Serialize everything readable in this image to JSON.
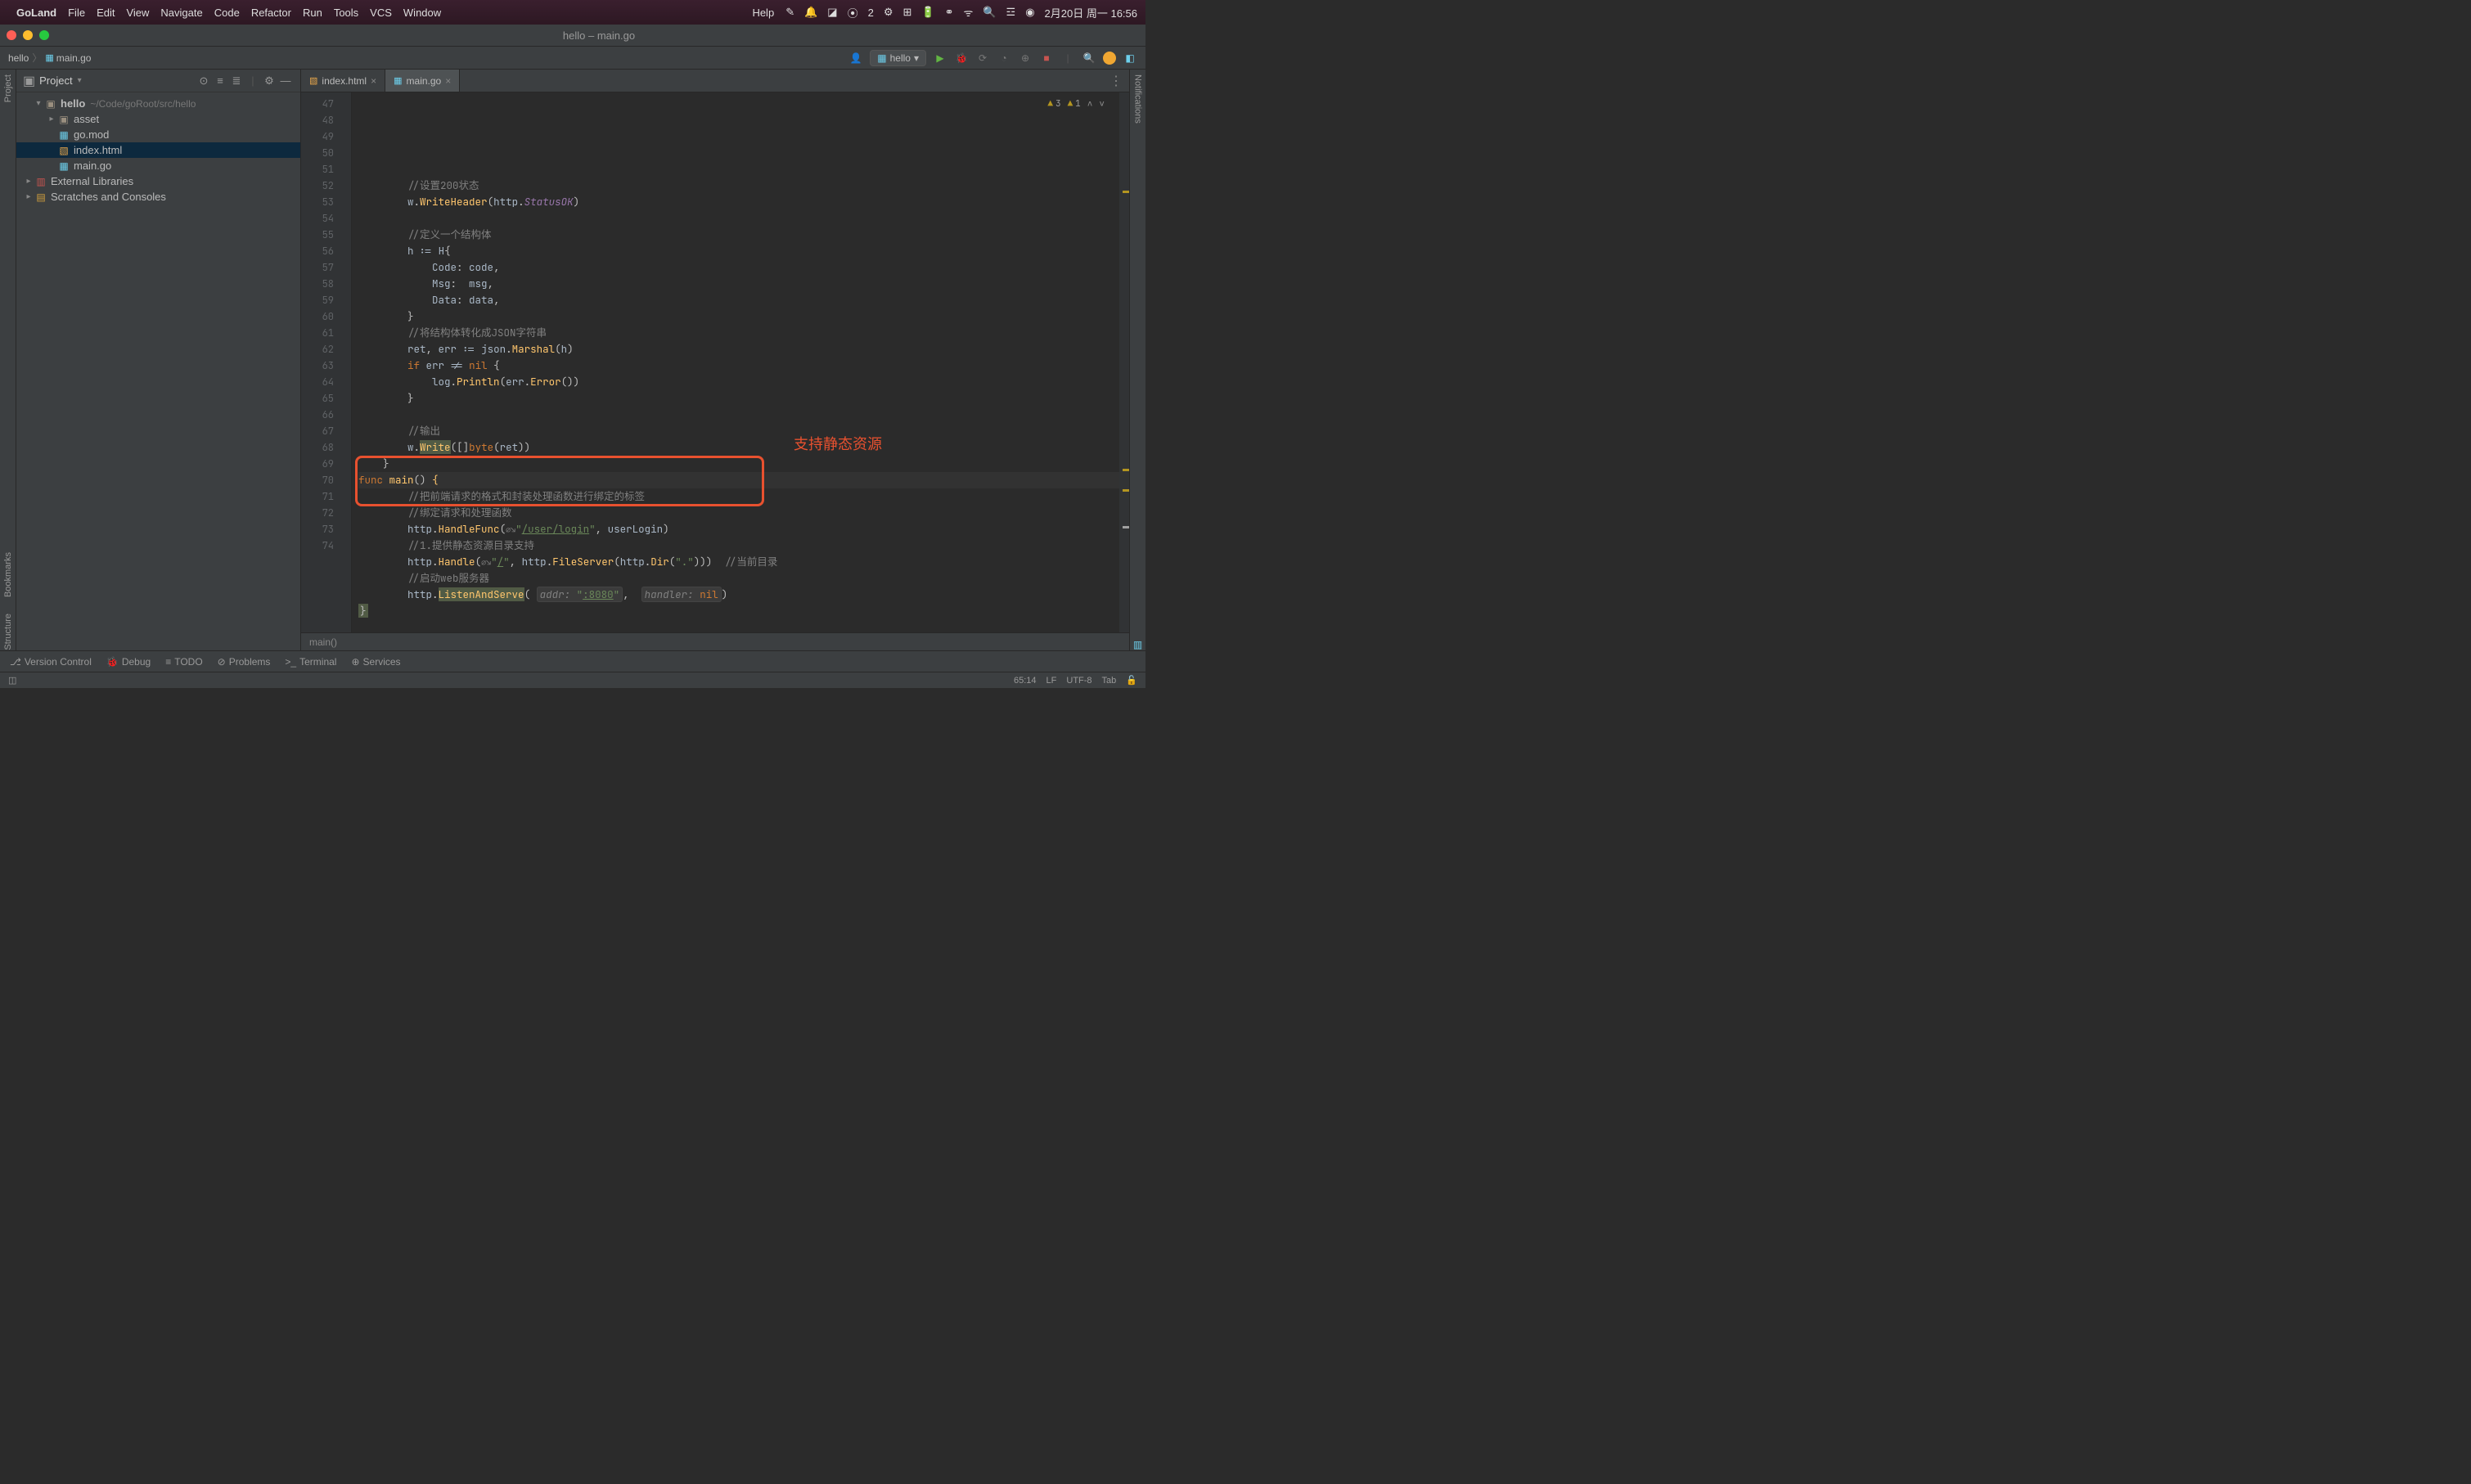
{
  "menubar": {
    "app": "GoLand",
    "items": [
      "File",
      "Edit",
      "View",
      "Navigate",
      "Code",
      "Refactor",
      "Run",
      "Tools",
      "VCS",
      "Window"
    ],
    "help": "Help",
    "wechat_count": "2",
    "datetime": "2月20日 周一  16:56"
  },
  "titlebar": {
    "title": "hello – main.go"
  },
  "breadcrumb": {
    "root": "hello",
    "file": "main.go"
  },
  "run_config": {
    "label": "hello"
  },
  "project_panel": {
    "title": "Project",
    "root": {
      "name": "hello",
      "path": "~/Code/goRoot/src/hello"
    },
    "items": [
      {
        "name": "asset",
        "type": "folder",
        "depth": 2
      },
      {
        "name": "go.mod",
        "type": "go",
        "depth": 2
      },
      {
        "name": "index.html",
        "type": "html",
        "depth": 2,
        "selected": true
      },
      {
        "name": "main.go",
        "type": "go",
        "depth": 2
      }
    ],
    "external": "External Libraries",
    "scratches": "Scratches and Consoles"
  },
  "tabs": [
    {
      "label": "index.html",
      "icon": "html",
      "active": false
    },
    {
      "label": "main.go",
      "icon": "go",
      "active": true
    }
  ],
  "inspections": {
    "errors": "3",
    "warnings": "1"
  },
  "code_crumb": "main()",
  "annotation_label": "支持静态资源",
  "gutter_start": 47,
  "code_lines": [
    {
      "n": 47,
      "html": "        <span class='cmt'>//设置200状态</span>"
    },
    {
      "n": 48,
      "html": "        <span class='id'>w</span>.<span class='fn'>WriteHeader</span>(<span class='pkg'>http</span>.<span class='id' style='font-style:italic;color:#9876aa'>StatusOK</span>)"
    },
    {
      "n": 49,
      "html": ""
    },
    {
      "n": 50,
      "html": "        <span class='cmt'>//定义一个结构体</span>"
    },
    {
      "n": 51,
      "html": "        <span class='id'>h</span> <span class='op'>:=</span> <span class='id'>H</span>{"
    },
    {
      "n": 52,
      "html": "            <span class='id'>Code</span>: <span class='id'>code</span>,"
    },
    {
      "n": 53,
      "html": "            <span class='id'>Msg</span>:  <span class='id'>msg</span>,"
    },
    {
      "n": 54,
      "html": "            <span class='id'>Data</span>: <span class='id'>data</span>,"
    },
    {
      "n": 55,
      "html": "        }"
    },
    {
      "n": 56,
      "html": "        <span class='cmt'>//将结构体转化成JSON字符串</span>"
    },
    {
      "n": 57,
      "html": "        <span class='id'>ret</span>, <span class='id'>err</span> <span class='op'>:=</span> <span class='pkg'>json</span>.<span class='fn'>Marshal</span>(<span class='id'>h</span>)"
    },
    {
      "n": 58,
      "html": "        <span class='kw'>if</span> <span class='id'>err</span> <span class='op'>!=</span> <span class='kw'>nil</span> {"
    },
    {
      "n": 59,
      "html": "            <span class='pkg'>log</span>.<span class='fn'>Println</span>(<span class='id'>err</span>.<span class='fn'>Error</span>())"
    },
    {
      "n": 60,
      "html": "        }"
    },
    {
      "n": 61,
      "html": ""
    },
    {
      "n": 62,
      "html": "        <span class='cmt'>//输出</span>"
    },
    {
      "n": 63,
      "html": "        <span class='id'>w</span>.<span class='fn hl'>Write</span>([]<span class='kw'>byte</span>(<span class='id'>ret</span>))"
    },
    {
      "n": 64,
      "html": "    }"
    },
    {
      "n": 65,
      "run": true,
      "html": "<span class='kw'>func</span> <span class='fn'>main</span>() <span class='fn'>{</span>",
      "cursor": true
    },
    {
      "n": 66,
      "html": "        <span class='cmt'>//把前端请求的格式和封装处理函数进行绑定的标签</span>"
    },
    {
      "n": 67,
      "html": "        <span class='cmt'>//绑定请求和处理函数</span>"
    },
    {
      "n": 68,
      "html": "        <span class='pkg'>http</span>.<span class='fn'>HandleFunc</span>(<span class='inlay'>⌀↘</span><span class='str'>\"</span><span class='link'>/user/login</span><span class='str'>\"</span>, <span class='id'>userLogin</span>)"
    },
    {
      "n": 69,
      "html": "        <span class='cmt'>//1.提供静态资源目录支持</span>"
    },
    {
      "n": 70,
      "html": "        <span class='pkg'>http</span>.<span class='fn'>Handle</span>(<span class='inlay'>⌀↘</span><span class='str'>\"</span><span class='link'>/</span><span class='str'>\"</span>, <span class='pkg'>http</span>.<span class='fn'>FileServer</span>(<span class='pkg'>http</span>.<span class='fn'>Dir</span>(<span class='str'>\".\"</span>)))  <span class='cmt'>//当前目录</span>"
    },
    {
      "n": 71,
      "html": "        <span class='cmt'>//启动web服务器</span>"
    },
    {
      "n": 72,
      "html": "        <span class='pkg'>http</span>.<span class='fn hl'>ListenAndServe</span>( <span class='parambox'><span class='param'>addr:</span> <span class='str'>\"</span><span class='link'>:8080</span><span class='str'>\"</span></span>,  <span class='parambox'><span class='param'>handler:</span> <span class='kw'>nil</span></span>)"
    },
    {
      "n": 73,
      "html": "<span class='hl' style='padding:0 2px'>}</span>"
    },
    {
      "n": 74,
      "html": ""
    }
  ],
  "bottom_tools": [
    {
      "icon": "⎇",
      "label": "Version Control"
    },
    {
      "icon": "🐞",
      "label": "Debug"
    },
    {
      "icon": "≡",
      "label": "TODO"
    },
    {
      "icon": "⊘",
      "label": "Problems"
    },
    {
      "icon": ">_",
      "label": "Terminal"
    },
    {
      "icon": "⊕",
      "label": "Services"
    }
  ],
  "status": {
    "pos": "65:14",
    "lf": "LF",
    "enc": "UTF-8",
    "indent": "Tab"
  }
}
